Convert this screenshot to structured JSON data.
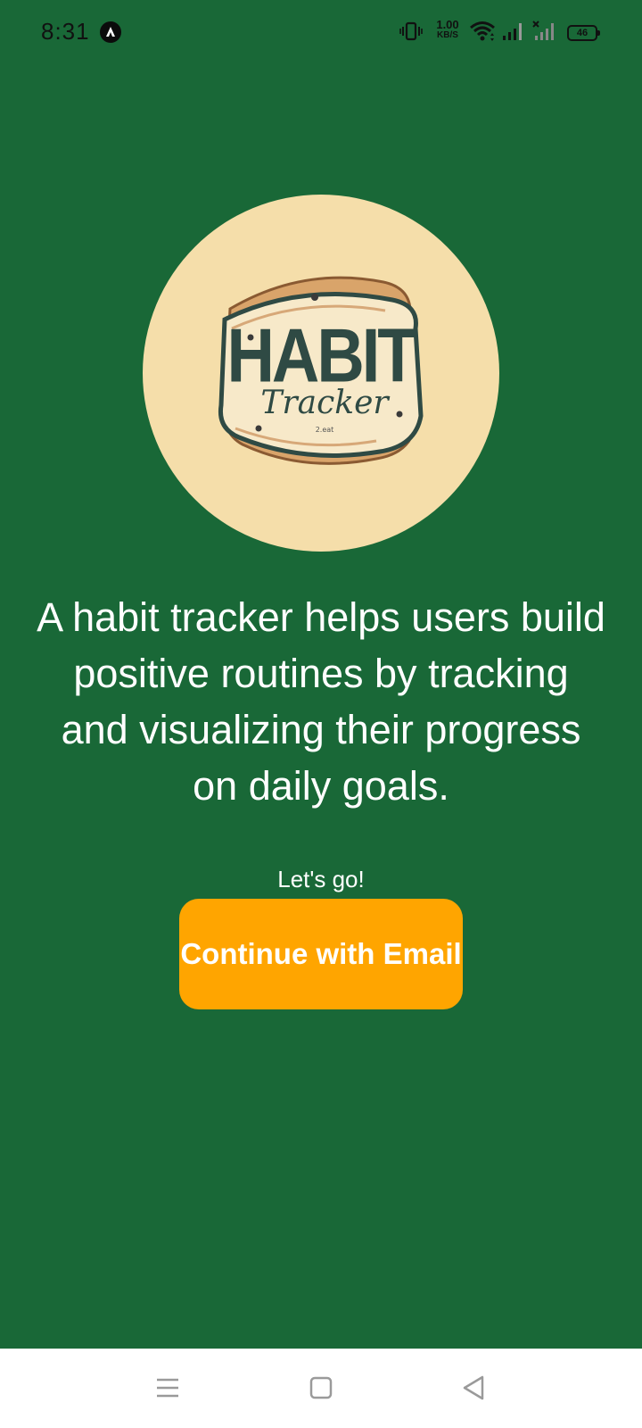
{
  "status_bar": {
    "time": "8:31",
    "net_speed_value": "1.00",
    "net_speed_unit": "KB/S",
    "battery": "46",
    "icons": [
      "app-notification-icon",
      "vibrate-icon",
      "wifi-icon",
      "signal-icon",
      "signal-no-service-icon",
      "battery-icon"
    ]
  },
  "logo": {
    "title": "HABIT",
    "subtitle": "Tracker",
    "small_text": "2.eat"
  },
  "description": "A habit tracker helps users build positive routines by tracking and visualizing their progress on daily goals.",
  "cta": {
    "caption": "Let's go!",
    "button_label": "Continue with Email"
  },
  "nav_bar": {
    "icons": [
      "menu-icon",
      "home-icon",
      "back-icon"
    ]
  },
  "colors": {
    "background": "#196837",
    "logo_circle": "#f5deaa",
    "button": "#ffa500",
    "text": "#ffffff"
  }
}
